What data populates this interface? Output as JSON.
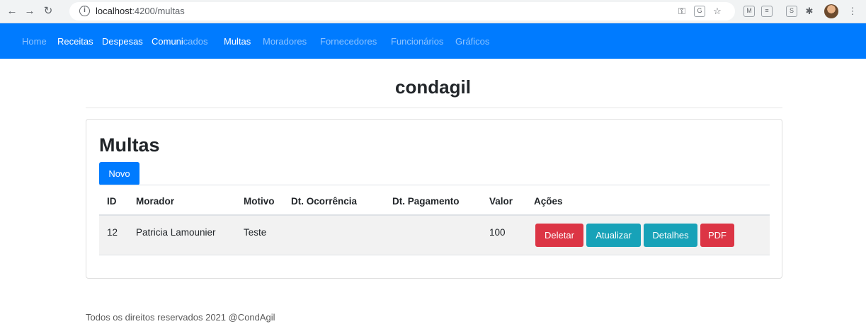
{
  "browser": {
    "url_host": "localhost",
    "url_path": ":4200/multas"
  },
  "nav": {
    "items": [
      {
        "label": "Home",
        "active": false
      },
      {
        "label": "Receitas",
        "active": true
      },
      {
        "label": "Despesas",
        "active": true
      },
      {
        "label": "Comunicados",
        "active": false
      },
      {
        "label": "Multas",
        "active": true
      },
      {
        "label": "Moradores",
        "active": false
      },
      {
        "label": "Fornecedores",
        "active": false
      },
      {
        "label": "Funcionários",
        "active": false
      },
      {
        "label": "Gráficos",
        "active": false
      }
    ]
  },
  "brand": "condagil",
  "card": {
    "title": "Multas",
    "new_button": "Novo"
  },
  "table": {
    "headers": [
      "ID",
      "Morador",
      "Motivo",
      "Dt. Ocorrência",
      "Dt. Pagamento",
      "Valor",
      "Ações"
    ],
    "rows": [
      {
        "id": "12",
        "morador": "Patricia Lamounier",
        "motivo": "Teste",
        "dt_ocorrencia": "",
        "dt_pagamento": "",
        "valor": "100"
      }
    ],
    "actions": {
      "delete": "Deletar",
      "update": "Atualizar",
      "details": "Detalhes",
      "pdf": "PDF"
    }
  },
  "footer": "Todos os direitos reservados 2021 @CondAgil",
  "colors": {
    "primary": "#007bff",
    "danger": "#dc3545",
    "info": "#17a2b8"
  }
}
